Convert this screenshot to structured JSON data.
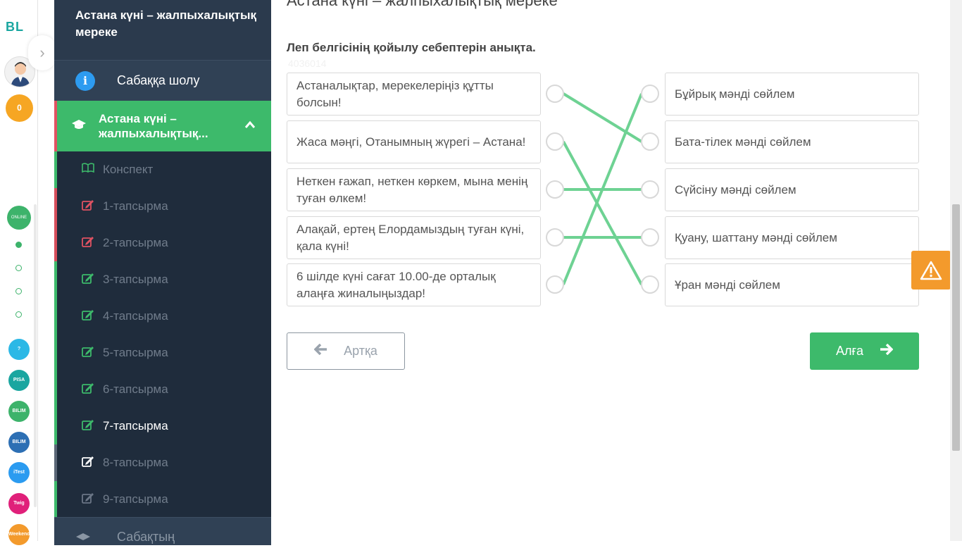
{
  "rail": {
    "logo": "BL",
    "coins": "0",
    "online_label": "ONLINE MEKTEP",
    "apps": [
      {
        "name": "help",
        "label": "?",
        "color": "#2bb8e6"
      },
      {
        "name": "pisa",
        "label": "PISA",
        "color": "#1aa6a0"
      },
      {
        "name": "bilimland",
        "label": "BILIM Land",
        "color": "#3db36b"
      },
      {
        "name": "bilimbook",
        "label": "BILIM Book",
        "color": "#2d6fb4"
      },
      {
        "name": "itest",
        "label": "iTest",
        "color": "#2b9bf0"
      },
      {
        "name": "twig",
        "label": "Twig",
        "color": "#e0207a"
      },
      {
        "name": "weekend",
        "label": "Weekend",
        "color": "#f39a2c"
      }
    ]
  },
  "sidebar": {
    "title": "Астана күні – жалпыхалықтық мереке",
    "review_label": "Сабаққа шолу",
    "lesson_label": "Астана күні – жалпыхалықтық...",
    "items": [
      {
        "label": "Конспект",
        "status": "green"
      },
      {
        "label": "1-тапсырма",
        "status": "red"
      },
      {
        "label": "2-тапсырма",
        "status": "red"
      },
      {
        "label": "3-тапсырма",
        "status": "green"
      },
      {
        "label": "4-тапсырма",
        "status": "green"
      },
      {
        "label": "5-тапсырма",
        "status": "green"
      },
      {
        "label": "6-тапсырма",
        "status": "green"
      },
      {
        "label": "7-тапсырма",
        "status": "green",
        "active": true
      },
      {
        "label": "8-тапсырма",
        "status": "grey"
      },
      {
        "label": "9-тапсырма",
        "status": "dim"
      }
    ],
    "next_label": "Сабақтың"
  },
  "main": {
    "title": "Астана күні – жалпыхалықтық мереке",
    "question": "Леп белгісінің қойылу себептерін анықта.",
    "question_id": "4036014",
    "left_items": [
      "Астаналықтар, мерекелеріңіз құтты болсын!",
      "Жаса мәңгі, Отанымның жүрегі – Астана!",
      "Неткен ғажап, неткен көркем, мына менің туған өлкем!",
      "Алақай, ертең Елордамыздың туған күні, қала күні!",
      "6 шілде күні сағат 10.00-де орталық алаңға жиналыңыздар!"
    ],
    "right_items": [
      "Бұйрық мәнді сөйлем",
      "Бата-тілек мәнді сөйлем",
      "Сүйсіну мәнді сөйлем",
      "Қуану, шаттану мәнді сөйлем",
      "Ұран мәнді сөйлем"
    ],
    "matches": [
      [
        0,
        1
      ],
      [
        1,
        4
      ],
      [
        2,
        2
      ],
      [
        3,
        3
      ],
      [
        4,
        0
      ]
    ],
    "line_color": "#6ed293",
    "back_label": "Артқа",
    "next_label": "Алға"
  }
}
